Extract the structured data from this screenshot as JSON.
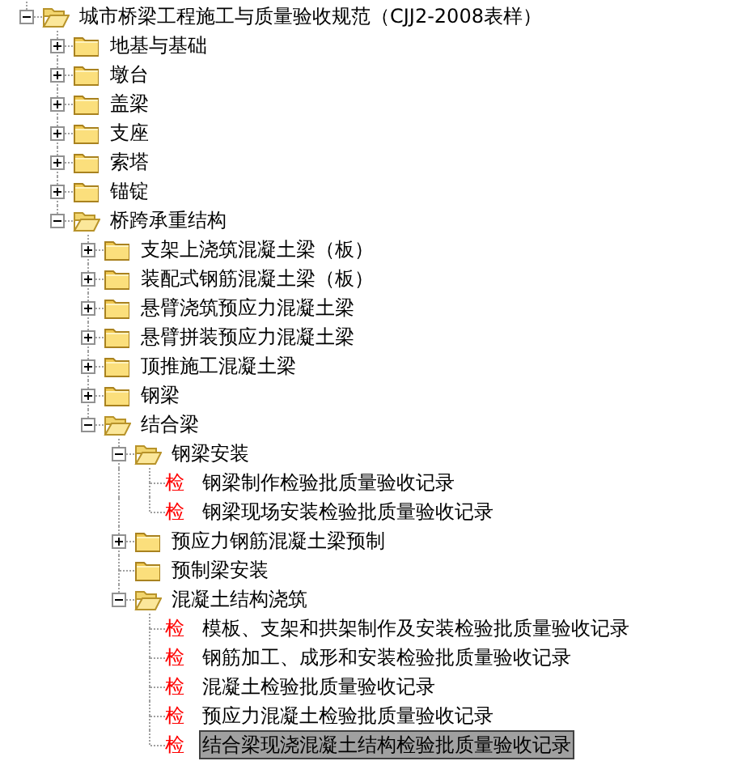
{
  "tree": {
    "kind": "folder",
    "expandable": true,
    "expanded": true,
    "selected": false,
    "label": "城市桥梁工程施工与质量验收规范（CJJ2-2008表样）",
    "children": [
      {
        "kind": "folder",
        "expandable": true,
        "expanded": false,
        "selected": false,
        "label": "地基与基础"
      },
      {
        "kind": "folder",
        "expandable": true,
        "expanded": false,
        "selected": false,
        "label": "墩台"
      },
      {
        "kind": "folder",
        "expandable": true,
        "expanded": false,
        "selected": false,
        "label": "盖梁"
      },
      {
        "kind": "folder",
        "expandable": true,
        "expanded": false,
        "selected": false,
        "label": "支座"
      },
      {
        "kind": "folder",
        "expandable": true,
        "expanded": false,
        "selected": false,
        "label": "索塔"
      },
      {
        "kind": "folder",
        "expandable": true,
        "expanded": false,
        "selected": false,
        "label": "锚锭"
      },
      {
        "kind": "folder",
        "expandable": true,
        "expanded": true,
        "selected": false,
        "label": "桥跨承重结构",
        "children": [
          {
            "kind": "folder",
            "expandable": true,
            "expanded": false,
            "selected": false,
            "label": "支架上浇筑混凝土梁（板）"
          },
          {
            "kind": "folder",
            "expandable": true,
            "expanded": false,
            "selected": false,
            "label": "装配式钢筋混凝土梁（板）"
          },
          {
            "kind": "folder",
            "expandable": true,
            "expanded": false,
            "selected": false,
            "label": "悬臂浇筑预应力混凝土梁"
          },
          {
            "kind": "folder",
            "expandable": true,
            "expanded": false,
            "selected": false,
            "label": "悬臂拼装预应力混凝土梁"
          },
          {
            "kind": "folder",
            "expandable": true,
            "expanded": false,
            "selected": false,
            "label": "顶推施工混凝土梁"
          },
          {
            "kind": "folder",
            "expandable": true,
            "expanded": false,
            "selected": false,
            "label": "钢梁"
          },
          {
            "kind": "folder",
            "expandable": true,
            "expanded": true,
            "selected": false,
            "label": "结合梁",
            "children": [
              {
                "kind": "folder",
                "expandable": true,
                "expanded": true,
                "selected": false,
                "label": "钢梁安装",
                "children": [
                  {
                    "kind": "doc",
                    "marker": "检",
                    "selected": false,
                    "label": "钢梁制作检验批质量验收记录"
                  },
                  {
                    "kind": "doc",
                    "marker": "检",
                    "selected": false,
                    "label": "钢梁现场安装检验批质量验收记录"
                  }
                ]
              },
              {
                "kind": "folder",
                "expandable": true,
                "expanded": false,
                "selected": false,
                "label": "预应力钢筋混凝土梁预制"
              },
              {
                "kind": "folder",
                "expandable": false,
                "expanded": false,
                "selected": false,
                "label": "预制梁安装"
              },
              {
                "kind": "folder",
                "expandable": true,
                "expanded": true,
                "selected": false,
                "label": "混凝土结构浇筑",
                "children": [
                  {
                    "kind": "doc",
                    "marker": "检",
                    "selected": false,
                    "label": "模板、支架和拱架制作及安装检验批质量验收记录"
                  },
                  {
                    "kind": "doc",
                    "marker": "检",
                    "selected": false,
                    "label": "钢筋加工、成形和安装检验批质量验收记录"
                  },
                  {
                    "kind": "doc",
                    "marker": "检",
                    "selected": false,
                    "label": "混凝土检验批质量验收记录"
                  },
                  {
                    "kind": "doc",
                    "marker": "检",
                    "selected": false,
                    "label": "预应力混凝土检验批质量验收记录"
                  },
                  {
                    "kind": "doc",
                    "marker": "检",
                    "selected": true,
                    "label": "结合梁现浇混凝土结构检验批质量验收记录"
                  }
                ]
              }
            ]
          }
        ]
      }
    ]
  }
}
